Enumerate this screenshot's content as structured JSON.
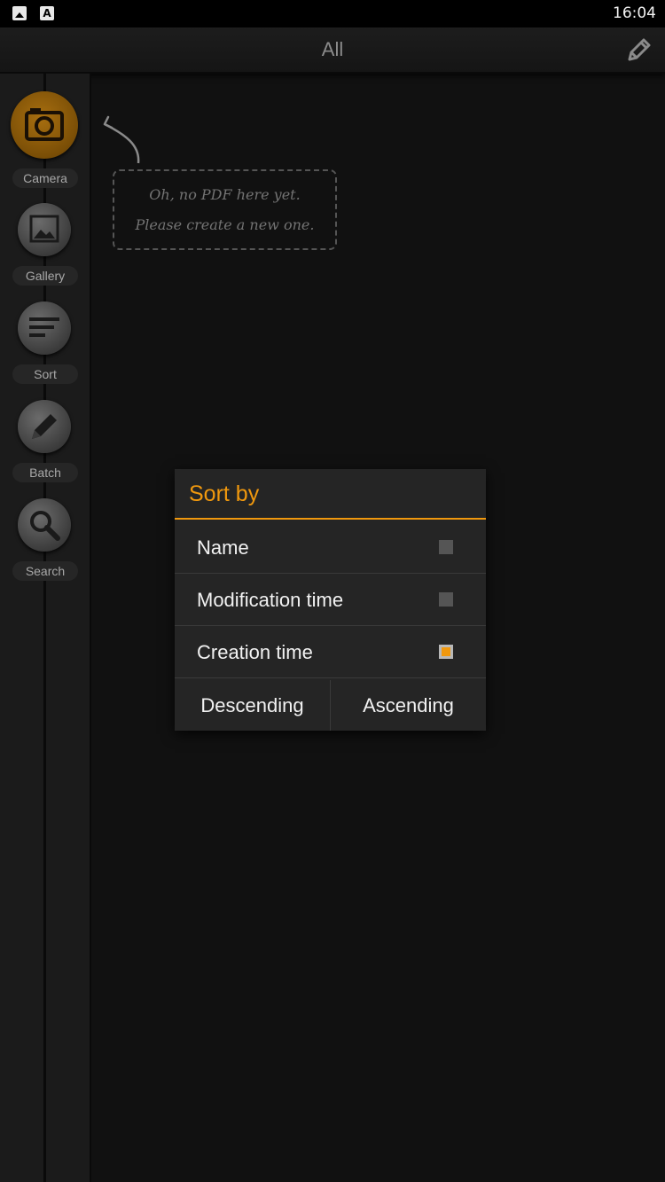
{
  "status_bar": {
    "time": "16:04",
    "icons": [
      "gallery-icon",
      "font-icon"
    ]
  },
  "top_bar": {
    "title": "All",
    "edit_icon": "pencil-icon"
  },
  "sidebar": {
    "items": [
      {
        "label": "Camera",
        "icon": "camera-icon",
        "active": true
      },
      {
        "label": "Gallery",
        "icon": "image-icon"
      },
      {
        "label": "Sort",
        "icon": "sort-lines-icon"
      },
      {
        "label": "Batch",
        "icon": "pencil-icon"
      },
      {
        "label": "Search",
        "icon": "magnifier-icon"
      }
    ]
  },
  "empty_state": {
    "line1": "Oh, no PDF here yet.",
    "line2": "Please create a new one."
  },
  "sort_dialog": {
    "title": "Sort by",
    "options": [
      {
        "label": "Name",
        "checked": false
      },
      {
        "label": "Modification time",
        "checked": false
      },
      {
        "label": "Creation time",
        "checked": true
      }
    ],
    "descending_label": "Descending",
    "ascending_label": "Ascending"
  },
  "colors": {
    "accent": "#f0980e",
    "background": "#111111",
    "dialog": "#252525"
  }
}
